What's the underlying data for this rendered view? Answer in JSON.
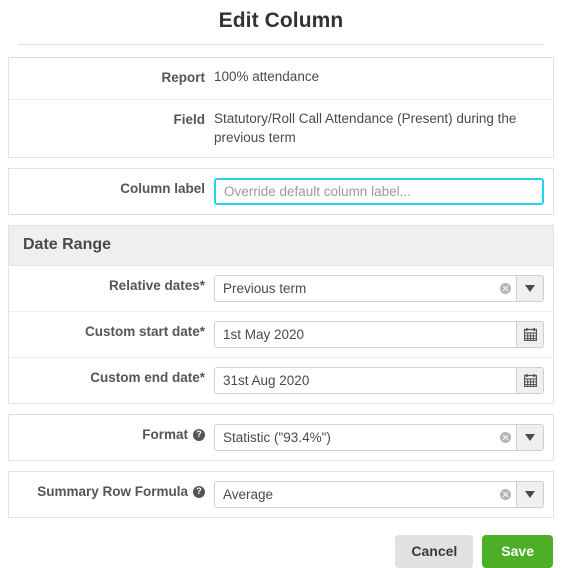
{
  "dialog": {
    "title": "Edit Column"
  },
  "info": {
    "report_label": "Report",
    "report_value": "100% attendance",
    "field_label": "Field",
    "field_value": "Statutory/Roll Call Attendance (Present) during the previous term"
  },
  "column_label": {
    "label": "Column label",
    "value": "",
    "placeholder": "Override default column label..."
  },
  "date_range": {
    "section_title": "Date Range",
    "relative_dates": {
      "label": "Relative dates*",
      "value": "Previous term",
      "clear_icon": "clear-circle-icon",
      "dropdown_icon": "chevron-down-icon"
    },
    "custom_start_date": {
      "label": "Custom start date*",
      "value": "1st May 2020",
      "calendar_icon": "calendar-icon"
    },
    "custom_end_date": {
      "label": "Custom end date*",
      "value": "31st Aug 2020",
      "calendar_icon": "calendar-icon"
    }
  },
  "format": {
    "label": "Format",
    "help_icon": "help-icon",
    "help_glyph": "?",
    "value": "Statistic (\"93.4%\")",
    "clear_icon": "clear-circle-icon",
    "dropdown_icon": "chevron-down-icon"
  },
  "summary_row_formula": {
    "label": "Summary Row Formula",
    "help_icon": "help-icon",
    "help_glyph": "?",
    "value": "Average",
    "clear_icon": "clear-circle-icon",
    "dropdown_icon": "chevron-down-icon"
  },
  "footer": {
    "cancel_label": "Cancel",
    "save_label": "Save"
  },
  "colors": {
    "save_green": "#4caf26",
    "cancel_gray": "#e2e0e0",
    "focus_cyan": "#22d3ee",
    "section_head_gray": "#efefef",
    "text_dark": "#333333"
  }
}
